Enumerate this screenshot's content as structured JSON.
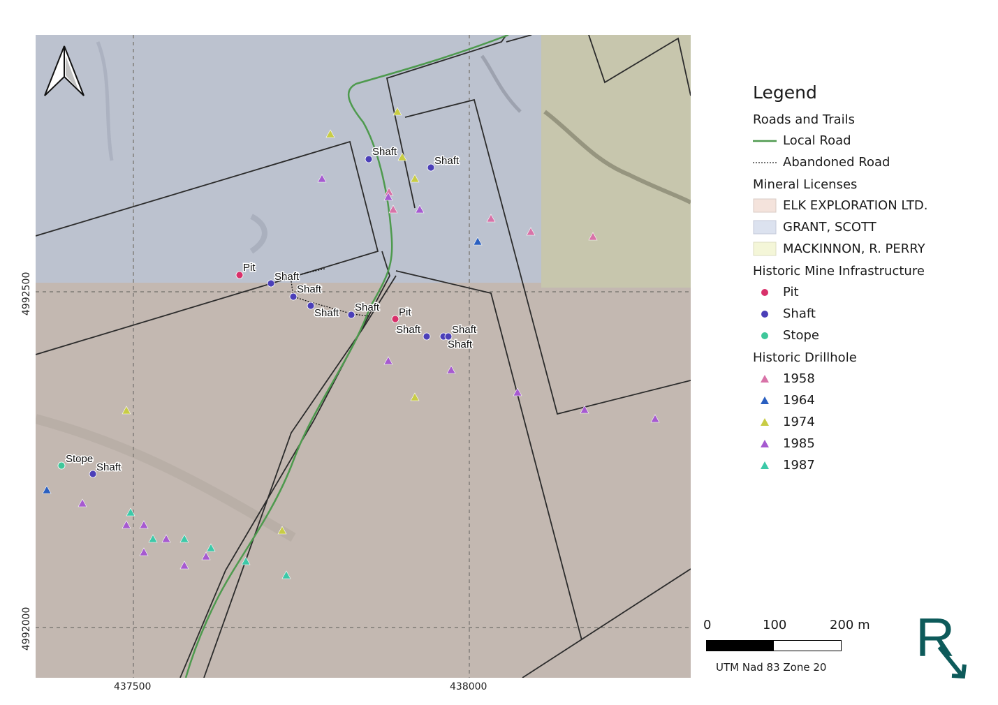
{
  "colors": {
    "local_road": "#4e9a4e",
    "abandoned_road": "#222222",
    "elk": "#f4e3dc",
    "grant": "#dce2ef",
    "mackinnon": "#f4f6d8",
    "pit": "#d8306a",
    "shaft": "#4b3fb8",
    "stope": "#3fc79a",
    "dh1958": "#d873a8",
    "dh1964": "#2a5fc0",
    "dh1974": "#c8cc45",
    "dh1985": "#a65ad0",
    "dh1987": "#3cc9a8",
    "logo": "#0d5a5a"
  },
  "axes": {
    "x_ticks": [
      "437500",
      "438000"
    ],
    "y_ticks": [
      "4992500",
      "4992000"
    ]
  },
  "north_arrow": {
    "icon": "north-arrow-icon"
  },
  "legend": {
    "title": "Legend",
    "groups": [
      {
        "title": "Roads and Trails",
        "items": [
          {
            "label": "Local Road",
            "symbol": "line",
            "color": "local_road"
          },
          {
            "label": "Abandoned Road",
            "symbol": "dashed",
            "color": "abandoned_road"
          }
        ]
      },
      {
        "title": "Mineral Licenses",
        "items": [
          {
            "label": "ELK EXPLORATION LTD.",
            "symbol": "box",
            "color": "elk"
          },
          {
            "label": "GRANT, SCOTT",
            "symbol": "box",
            "color": "grant"
          },
          {
            "label": "MACKINNON, R. PERRY",
            "symbol": "box",
            "color": "mackinnon"
          }
        ]
      },
      {
        "title": "Historic Mine Infrastructure",
        "items": [
          {
            "label": "Pit",
            "symbol": "circle",
            "color": "pit"
          },
          {
            "label": "Shaft",
            "symbol": "circle",
            "color": "shaft"
          },
          {
            "label": "Stope",
            "symbol": "circle",
            "color": "stope"
          }
        ]
      },
      {
        "title": "Historic Drillhole",
        "items": [
          {
            "label": "1958",
            "symbol": "triangle",
            "color": "dh1958"
          },
          {
            "label": "1964",
            "symbol": "triangle",
            "color": "dh1964"
          },
          {
            "label": "1974",
            "symbol": "triangle",
            "color": "dh1974"
          },
          {
            "label": "1985",
            "symbol": "triangle",
            "color": "dh1985"
          },
          {
            "label": "1987",
            "symbol": "triangle",
            "color": "dh1987"
          }
        ]
      }
    ]
  },
  "scale_bar": {
    "ticks": [
      "0",
      "100",
      "200 m"
    ],
    "crs": "UTM Nad 83 Zone 20"
  },
  "map_labels": {
    "pit_1": "Pit",
    "pit_2": "Pit",
    "shaft_1": "Shaft",
    "shaft_2": "Shaft",
    "shaft_3": "Shaft",
    "shaft_4": "Shaft",
    "shaft_5": "Shaft",
    "shaft_6": "Shaft",
    "shaft_7": "Shaft",
    "shaft_8": "Shaft",
    "shaft_9": "Shaft",
    "shaft_10": "Shaft",
    "stope_1": "Stope"
  },
  "logo": {
    "letter": "R"
  }
}
